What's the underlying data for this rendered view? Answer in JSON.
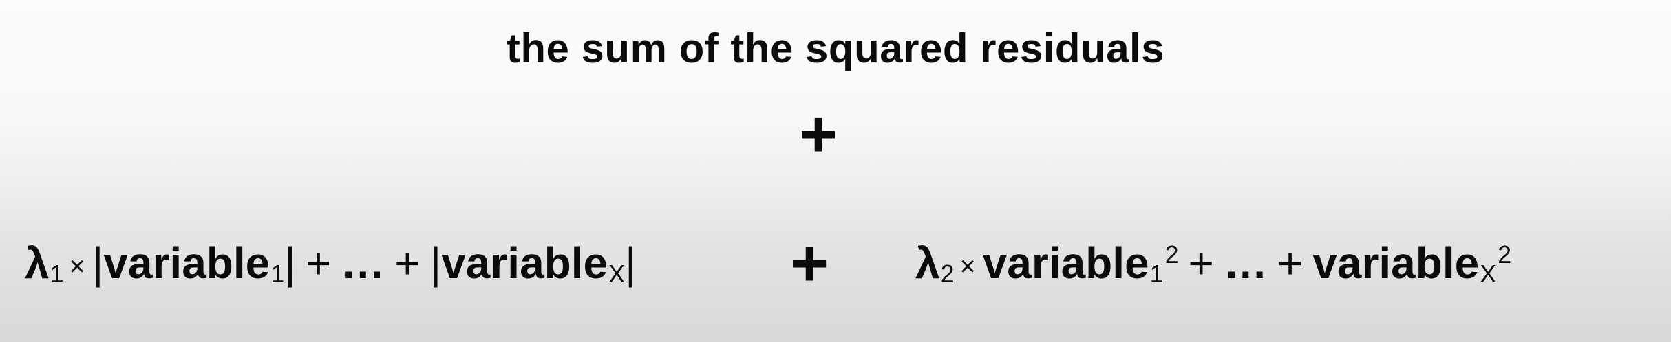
{
  "heading": "the sum of the squared residuals",
  "plus": "+",
  "lasso": {
    "lambda": "λ",
    "lambda_sub": "1",
    "times": "×",
    "bar": "|",
    "var_first": "variable",
    "var_first_sub": "1",
    "op1": "+",
    "ellipsis": "…",
    "op2": "+",
    "var_last": "variable",
    "var_last_sub": "X"
  },
  "ridge": {
    "lambda": "λ",
    "lambda_sub": "2",
    "times": "×",
    "var_first": "variable",
    "var_first_sub": "1",
    "var_first_sup": "2",
    "op1": "+",
    "ellipsis": "…",
    "op2": "+",
    "var_last": "variable",
    "var_last_sub": "X",
    "var_last_sup": "2"
  }
}
